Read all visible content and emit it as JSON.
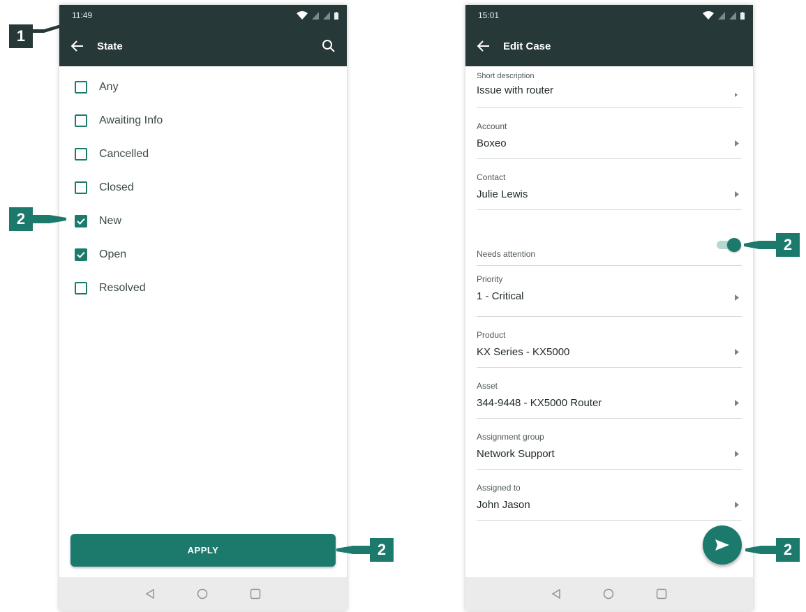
{
  "left_screen": {
    "status_time": "11:49",
    "toolbar_title": "State",
    "options": [
      {
        "label": "Any",
        "checked": false
      },
      {
        "label": "Awaiting Info",
        "checked": false
      },
      {
        "label": "Cancelled",
        "checked": false
      },
      {
        "label": "Closed",
        "checked": false
      },
      {
        "label": "New",
        "checked": true
      },
      {
        "label": "Open",
        "checked": true
      },
      {
        "label": "Resolved",
        "checked": false
      }
    ],
    "apply_label": "APPLY"
  },
  "right_screen": {
    "status_time": "15:01",
    "toolbar_title": "Edit Case",
    "fields": [
      {
        "label": "Short description",
        "value": "Issue with router"
      },
      {
        "label": "Account",
        "value": "Boxeo"
      },
      {
        "label": "Contact",
        "value": "Julie Lewis"
      }
    ],
    "toggle": {
      "label": "Needs attention",
      "on": true
    },
    "fields2": [
      {
        "label": "Priority",
        "value": "1 - Critical"
      },
      {
        "label": "Product",
        "value": "KX Series - KX5000"
      },
      {
        "label": "Asset",
        "value": "344-9448 - KX5000 Router"
      },
      {
        "label": "Assignment group",
        "value": "Network Support"
      },
      {
        "label": "Assigned to",
        "value": "John Jason"
      }
    ]
  },
  "callouts": {
    "toolbar_marker": "1",
    "checkbox_marker": "2",
    "apply_marker": "2",
    "toggle_marker": "2",
    "fab_marker": "2"
  },
  "colors": {
    "teal": "#1c7a6c",
    "dark": "#263838"
  },
  "icons": {
    "back": "arrow-left-icon",
    "search": "search-icon",
    "fab": "send-icon",
    "nav": [
      "nav-back-icon",
      "nav-home-icon",
      "nav-recents-icon"
    ]
  }
}
